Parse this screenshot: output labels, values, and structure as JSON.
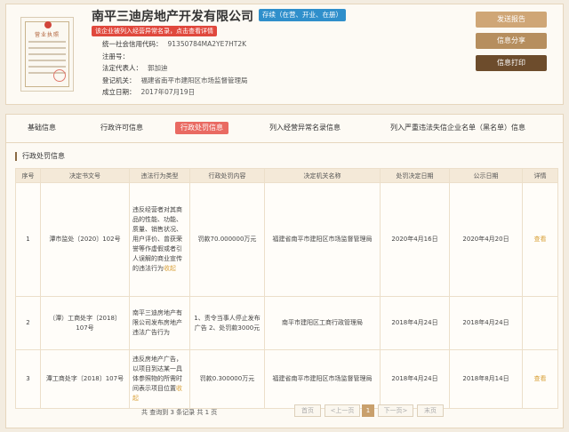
{
  "company": {
    "name": "南平三迪房地产开发有限公司",
    "status": "存续（在营、开业、在册）",
    "abnormal_notice": "该企业被列入经营异常名录，点击查看详情",
    "license_title": "营业执照",
    "fields": [
      {
        "label": "统一社会信用代码：",
        "value": "91350784MA2YE7HT2K"
      },
      {
        "label": "注册号：",
        "value": ""
      },
      {
        "label": "法定代表人：",
        "value": "郭加迪"
      },
      {
        "label": "登记机关：",
        "value": "福建省南平市建阳区市场监督管理局"
      },
      {
        "label": "成立日期：",
        "value": "2017年07月19日"
      }
    ]
  },
  "actions": {
    "report": "发送报告",
    "share": "信息分享",
    "print": "信息打印"
  },
  "tabs": [
    {
      "label": "基础信息"
    },
    {
      "label": "行政许可信息"
    },
    {
      "label": "行政处罚信息",
      "active": true
    },
    {
      "label": "列入经营异常名录信息"
    },
    {
      "label": "列入严重违法失信企业名单（黑名单）信息"
    }
  ],
  "section_title": "行政处罚信息",
  "table": {
    "headers": [
      "序号",
      "决定书文号",
      "违法行为类型",
      "行政处罚内容",
      "决定机关名称",
      "处罚决定日期",
      "公示日期",
      "详情"
    ],
    "rows": [
      {
        "no": "1",
        "doc": "潭市监处〔2020〕102号",
        "type": "违反经营者对其商品的性能、功能、质量、销售状况、用户评价、曾获荣誉等作虚假或者引人误解的商业宣传的违法行为",
        "more": "收起",
        "content": "罚款70.000000万元",
        "agency": "福建省南平市建阳区市场监督管理局",
        "decision_date": "2020年4月16日",
        "publish_date": "2020年4月20日",
        "detail": "查看"
      },
      {
        "no": "2",
        "doc": "（潭）工商处字〔2018〕107号",
        "type": "南平三迪房地产有限公司发布房地产违法广告行为",
        "more": "",
        "content": "1、责令当事人停止发布广告 2、处罚款3000元",
        "agency": "南平市建阳区工商行政管理局",
        "decision_date": "2018年4月24日",
        "publish_date": "2018年4月24日",
        "detail": ""
      },
      {
        "no": "3",
        "doc": "潭工商处字〔2018〕107号",
        "type": "违反房地产广告，以项目到达某一具体参照物的所需时间表示项目位置",
        "more": "收起",
        "content": "罚款0.300000万元",
        "agency": "福建省南平市建阳区市场监督管理局",
        "decision_date": "2018年4月24日",
        "publish_date": "2018年8月14日",
        "detail": "查看"
      }
    ]
  },
  "pager": {
    "summary": "共 查询到 3 条记录 共 1 页",
    "first": "首页",
    "prev": "<上一页",
    "current": "1",
    "next": "下一页>",
    "last": "末页"
  },
  "colors": {
    "accent": "#e96a62",
    "gold": "#cfa676",
    "dark_brown": "#6d4c2c",
    "status_blue": "#2f8fcb",
    "alert_red": "#e0483d"
  }
}
